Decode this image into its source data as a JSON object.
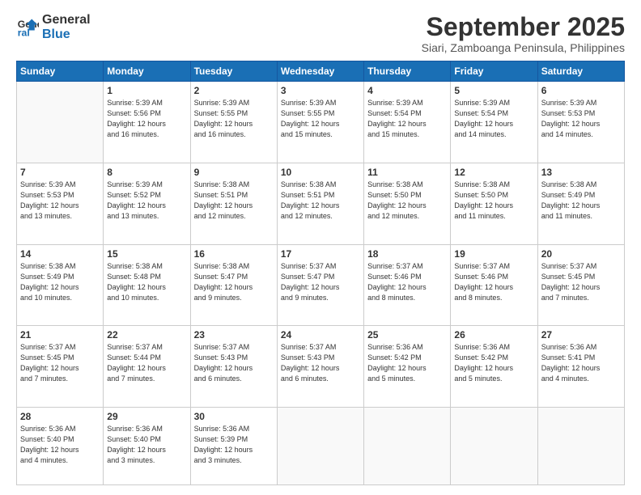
{
  "logo": {
    "line1": "General",
    "line2": "Blue"
  },
  "title": "September 2025",
  "subtitle": "Siari, Zamboanga Peninsula, Philippines",
  "days_header": [
    "Sunday",
    "Monday",
    "Tuesday",
    "Wednesday",
    "Thursday",
    "Friday",
    "Saturday"
  ],
  "weeks": [
    [
      {
        "num": "",
        "info": ""
      },
      {
        "num": "1",
        "info": "Sunrise: 5:39 AM\nSunset: 5:56 PM\nDaylight: 12 hours\nand 16 minutes."
      },
      {
        "num": "2",
        "info": "Sunrise: 5:39 AM\nSunset: 5:55 PM\nDaylight: 12 hours\nand 16 minutes."
      },
      {
        "num": "3",
        "info": "Sunrise: 5:39 AM\nSunset: 5:55 PM\nDaylight: 12 hours\nand 15 minutes."
      },
      {
        "num": "4",
        "info": "Sunrise: 5:39 AM\nSunset: 5:54 PM\nDaylight: 12 hours\nand 15 minutes."
      },
      {
        "num": "5",
        "info": "Sunrise: 5:39 AM\nSunset: 5:54 PM\nDaylight: 12 hours\nand 14 minutes."
      },
      {
        "num": "6",
        "info": "Sunrise: 5:39 AM\nSunset: 5:53 PM\nDaylight: 12 hours\nand 14 minutes."
      }
    ],
    [
      {
        "num": "7",
        "info": "Sunrise: 5:39 AM\nSunset: 5:53 PM\nDaylight: 12 hours\nand 13 minutes."
      },
      {
        "num": "8",
        "info": "Sunrise: 5:39 AM\nSunset: 5:52 PM\nDaylight: 12 hours\nand 13 minutes."
      },
      {
        "num": "9",
        "info": "Sunrise: 5:38 AM\nSunset: 5:51 PM\nDaylight: 12 hours\nand 12 minutes."
      },
      {
        "num": "10",
        "info": "Sunrise: 5:38 AM\nSunset: 5:51 PM\nDaylight: 12 hours\nand 12 minutes."
      },
      {
        "num": "11",
        "info": "Sunrise: 5:38 AM\nSunset: 5:50 PM\nDaylight: 12 hours\nand 12 minutes."
      },
      {
        "num": "12",
        "info": "Sunrise: 5:38 AM\nSunset: 5:50 PM\nDaylight: 12 hours\nand 11 minutes."
      },
      {
        "num": "13",
        "info": "Sunrise: 5:38 AM\nSunset: 5:49 PM\nDaylight: 12 hours\nand 11 minutes."
      }
    ],
    [
      {
        "num": "14",
        "info": "Sunrise: 5:38 AM\nSunset: 5:49 PM\nDaylight: 12 hours\nand 10 minutes."
      },
      {
        "num": "15",
        "info": "Sunrise: 5:38 AM\nSunset: 5:48 PM\nDaylight: 12 hours\nand 10 minutes."
      },
      {
        "num": "16",
        "info": "Sunrise: 5:38 AM\nSunset: 5:47 PM\nDaylight: 12 hours\nand 9 minutes."
      },
      {
        "num": "17",
        "info": "Sunrise: 5:37 AM\nSunset: 5:47 PM\nDaylight: 12 hours\nand 9 minutes."
      },
      {
        "num": "18",
        "info": "Sunrise: 5:37 AM\nSunset: 5:46 PM\nDaylight: 12 hours\nand 8 minutes."
      },
      {
        "num": "19",
        "info": "Sunrise: 5:37 AM\nSunset: 5:46 PM\nDaylight: 12 hours\nand 8 minutes."
      },
      {
        "num": "20",
        "info": "Sunrise: 5:37 AM\nSunset: 5:45 PM\nDaylight: 12 hours\nand 7 minutes."
      }
    ],
    [
      {
        "num": "21",
        "info": "Sunrise: 5:37 AM\nSunset: 5:45 PM\nDaylight: 12 hours\nand 7 minutes."
      },
      {
        "num": "22",
        "info": "Sunrise: 5:37 AM\nSunset: 5:44 PM\nDaylight: 12 hours\nand 7 minutes."
      },
      {
        "num": "23",
        "info": "Sunrise: 5:37 AM\nSunset: 5:43 PM\nDaylight: 12 hours\nand 6 minutes."
      },
      {
        "num": "24",
        "info": "Sunrise: 5:37 AM\nSunset: 5:43 PM\nDaylight: 12 hours\nand 6 minutes."
      },
      {
        "num": "25",
        "info": "Sunrise: 5:36 AM\nSunset: 5:42 PM\nDaylight: 12 hours\nand 5 minutes."
      },
      {
        "num": "26",
        "info": "Sunrise: 5:36 AM\nSunset: 5:42 PM\nDaylight: 12 hours\nand 5 minutes."
      },
      {
        "num": "27",
        "info": "Sunrise: 5:36 AM\nSunset: 5:41 PM\nDaylight: 12 hours\nand 4 minutes."
      }
    ],
    [
      {
        "num": "28",
        "info": "Sunrise: 5:36 AM\nSunset: 5:40 PM\nDaylight: 12 hours\nand 4 minutes."
      },
      {
        "num": "29",
        "info": "Sunrise: 5:36 AM\nSunset: 5:40 PM\nDaylight: 12 hours\nand 3 minutes."
      },
      {
        "num": "30",
        "info": "Sunrise: 5:36 AM\nSunset: 5:39 PM\nDaylight: 12 hours\nand 3 minutes."
      },
      {
        "num": "",
        "info": ""
      },
      {
        "num": "",
        "info": ""
      },
      {
        "num": "",
        "info": ""
      },
      {
        "num": "",
        "info": ""
      }
    ]
  ]
}
